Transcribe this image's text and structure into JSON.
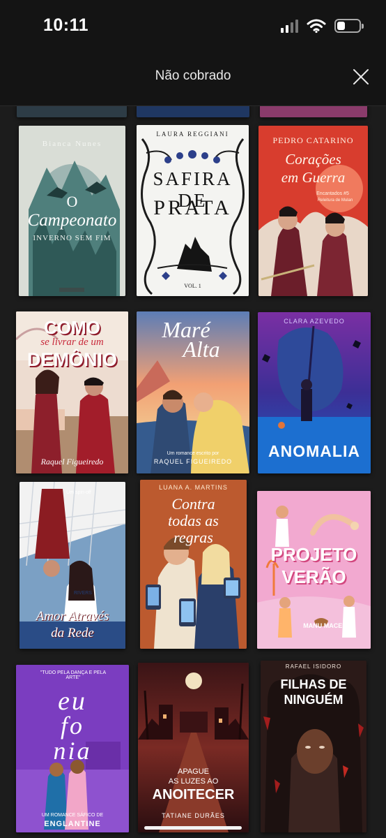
{
  "status_bar": {
    "time": "10:11",
    "battery_level": 0.35
  },
  "nav": {
    "title": "Não cobrado"
  },
  "books": [
    {
      "title": "Campeonato",
      "author": "Bianca Nunes",
      "subtitle": "Inverno sem fim",
      "title_first": "O"
    },
    {
      "author": "Laura Reggiani",
      "title_line1": "Safira de",
      "title_line2": "Prata",
      "volume": "Vol. 1"
    },
    {
      "author": "Pedro Catarino",
      "title_line1": "Corações",
      "title_line2": "em Guerra",
      "series": "Encantados #5",
      "note": "Releitura de Mulan"
    },
    {
      "title_line1": "Como",
      "title_line2": "se livrar de um",
      "title_line3": "Demônio",
      "author": "Raquel Figueiredo"
    },
    {
      "title_line1": "Maré",
      "title_line2": "Alta",
      "tagline": "Um romance escrito por",
      "author": "Raquel Figueiredo"
    },
    {
      "author": "Clara Azevedo",
      "title": "Anomalia"
    },
    {
      "title_line1": "Amor Através",
      "title_line2": "da Rede",
      "tagline": "Um spin-off",
      "jersey": "RIVERS"
    },
    {
      "author": "Luana A. Martins",
      "title_line1": "Contra",
      "title_line2": "todas as",
      "title_line3": "regras"
    },
    {
      "title_line1": "Projeto",
      "title_line2": "Verão",
      "author": "Manu Macedo"
    },
    {
      "quote": "\"Tudo pela dança e pela arte\"",
      "title_line1": "eu",
      "title_line2": "fo",
      "title_line3": "nia",
      "tagline": "Um romance sáfico de",
      "author": "Englantine"
    },
    {
      "title_line1": "Apague",
      "title_line2": "as luzes ao",
      "title_line3": "Anoitecer",
      "author": "Tatiane Durães"
    },
    {
      "author": "Rafael Isidoro",
      "title_line1": "Filhas de",
      "title_line2": "Ninguém"
    }
  ]
}
